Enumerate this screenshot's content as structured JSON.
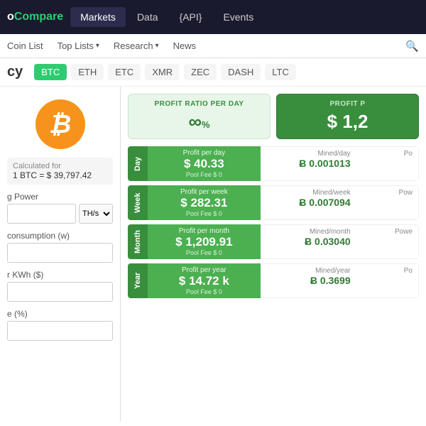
{
  "logo": {
    "prefix": "o",
    "name": "Compare"
  },
  "topNav": {
    "items": [
      {
        "id": "markets",
        "label": "Markets",
        "active": true
      },
      {
        "id": "data",
        "label": "Data",
        "active": false
      },
      {
        "id": "api",
        "label": "{API}",
        "active": false
      },
      {
        "id": "events",
        "label": "Events",
        "active": false
      }
    ]
  },
  "secondNav": {
    "items": [
      {
        "id": "coinlist",
        "label": "Coin List",
        "hasArrow": false
      },
      {
        "id": "toplists",
        "label": "Top Lists",
        "hasArrow": true
      },
      {
        "id": "research",
        "label": "Research",
        "hasArrow": true
      },
      {
        "id": "news",
        "label": "News",
        "hasArrow": false
      }
    ]
  },
  "coinTabs": {
    "pageTitle": "cy",
    "tabs": [
      {
        "id": "btc",
        "label": "BTC",
        "active": true
      },
      {
        "id": "eth",
        "label": "ETH",
        "active": false
      },
      {
        "id": "etc",
        "label": "ETC",
        "active": false
      },
      {
        "id": "xmr",
        "label": "XMR",
        "active": false
      },
      {
        "id": "zec",
        "label": "ZEC",
        "active": false
      },
      {
        "id": "dash",
        "label": "DASH",
        "active": false
      },
      {
        "id": "ltc",
        "label": "LTC",
        "active": false
      }
    ]
  },
  "leftPanel": {
    "calcFor": {
      "label": "Calculated for",
      "value": "1 BTC = $ 39,797.42"
    },
    "hashingPowerLabel": "g Power",
    "hashingPowerUnit": "TH/s",
    "powerConsumptionLabel": "consumption (w)",
    "costPerKWhLabel": "r KWh ($)",
    "poolFeeLabel": "e (%)"
  },
  "profitCards": [
    {
      "id": "profit-ratio-day",
      "label": "PROFIT RATIO PER DAY",
      "value": "∞",
      "unit": "%",
      "dark": false
    },
    {
      "id": "profit-month",
      "label": "PROFIT P",
      "value": "$ 1,2",
      "unit": "",
      "dark": true
    }
  ],
  "miningRows": [
    {
      "period": "Day",
      "profitLabel": "Profit per day",
      "profitValue": "$ 40.33",
      "poolFee": "Pool Fee $ 0",
      "minedLabel": "Mined/day",
      "minedValue": "Ƀ 0.001013",
      "powerLabel": "Po",
      "powerValue": ""
    },
    {
      "period": "Week",
      "profitLabel": "Profit per week",
      "profitValue": "$ 282.31",
      "poolFee": "Pool Fee $ 0",
      "minedLabel": "Mined/week",
      "minedValue": "Ƀ 0.007094",
      "powerLabel": "Pow",
      "powerValue": ""
    },
    {
      "period": "Month",
      "profitLabel": "Profit per month",
      "profitValue": "$ 1,209.91",
      "poolFee": "Pool Fee $ 0",
      "minedLabel": "Mined/month",
      "minedValue": "Ƀ 0.03040",
      "powerLabel": "Powe",
      "powerValue": ""
    },
    {
      "period": "Year",
      "profitLabel": "Profit per year",
      "profitValue": "$ 14.72 k",
      "poolFee": "Pool Fee $ 0",
      "minedLabel": "Mined/year",
      "minedValue": "Ƀ 0.3699",
      "powerLabel": "Po",
      "powerValue": ""
    }
  ]
}
